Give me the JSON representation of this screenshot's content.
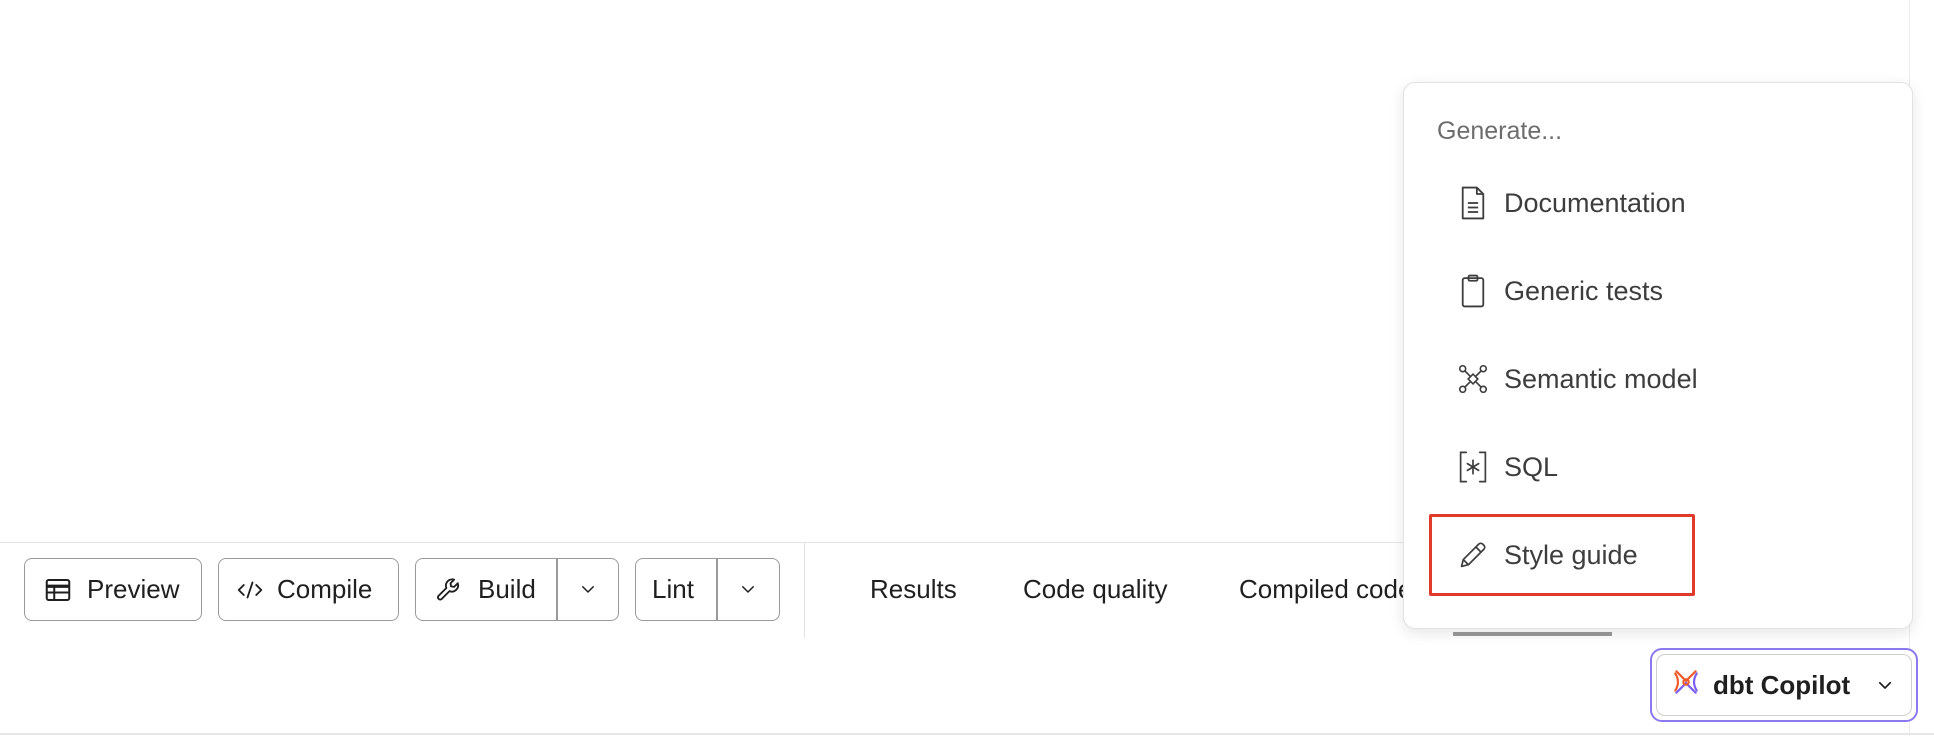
{
  "toolbar": {
    "preview_label": "Preview",
    "compile_label": "Compile",
    "build_label": "Build",
    "lint_label": "Lint"
  },
  "results_tabs": [
    {
      "label": "Results"
    },
    {
      "label": "Code quality"
    },
    {
      "label": "Compiled code"
    }
  ],
  "generate_menu": {
    "header": "Generate...",
    "items": [
      {
        "label": "Documentation",
        "icon": "document-icon"
      },
      {
        "label": "Generic tests",
        "icon": "clipboard-icon"
      },
      {
        "label": "Semantic model",
        "icon": "network-icon"
      },
      {
        "label": "SQL",
        "icon": "bracket-asterisk-icon"
      },
      {
        "label": "Style guide",
        "icon": "pencil-icon",
        "highlighted": true
      }
    ]
  },
  "copilot": {
    "label": "dbt Copilot"
  },
  "colors": {
    "highlight_border": "#e03a2a",
    "copilot_focus_ring": "#8b79f0",
    "copilot_logo_orange": "#f05a28",
    "copilot_logo_purple": "#7b5cf0"
  }
}
